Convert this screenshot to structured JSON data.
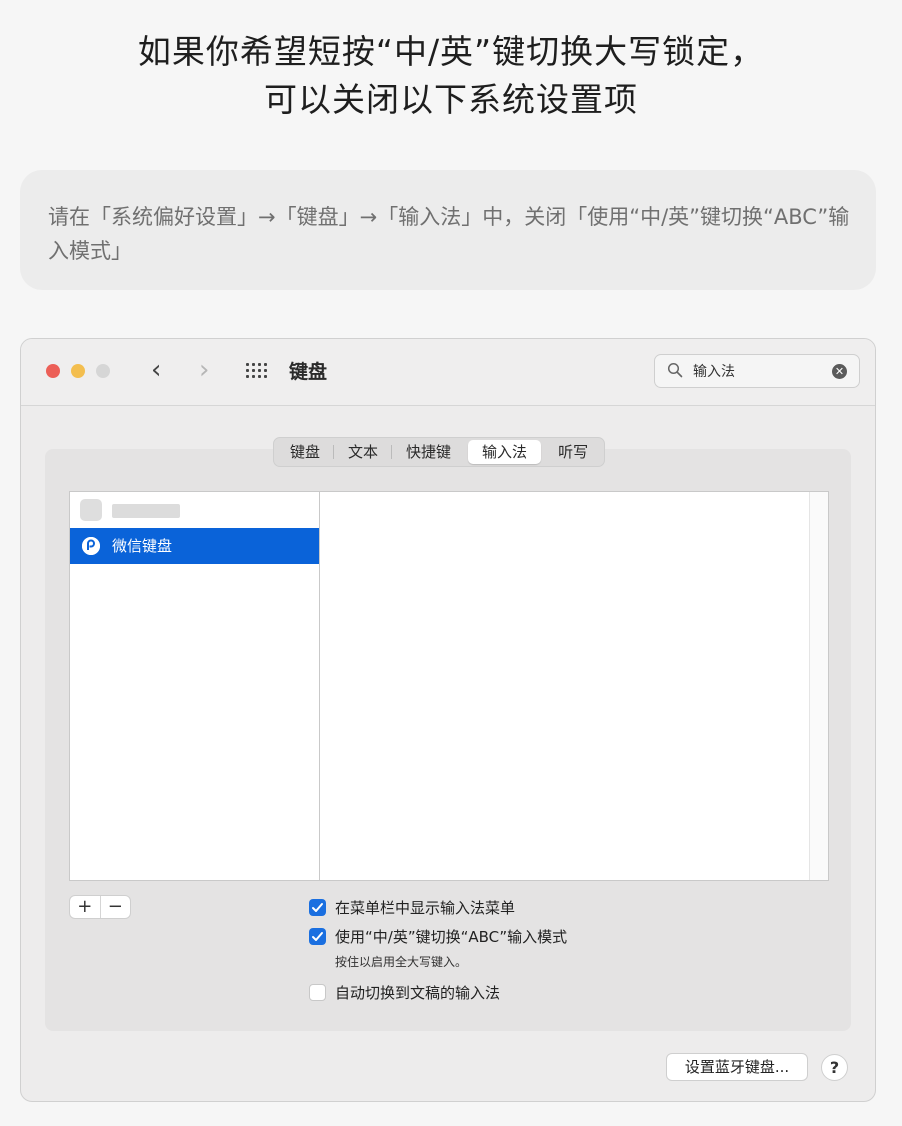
{
  "headline": {
    "line1": "如果你希望短按“中/英”键切换大写锁定，",
    "line2": "可以关闭以下系统设置项"
  },
  "instruction": {
    "text": "请在「系统偏好设置」→「键盘」→「输入法」中，关闭「使用“中/英”键切换“ABC”输入模式」"
  },
  "window": {
    "title": "键盘",
    "search": {
      "value": "输入法"
    },
    "tabs": [
      {
        "label": "键盘",
        "active": false
      },
      {
        "label": "文本",
        "active": false
      },
      {
        "label": "快捷键",
        "active": false
      },
      {
        "label": "输入法",
        "active": true
      },
      {
        "label": "听写",
        "active": false
      }
    ],
    "input_sources": [
      {
        "label": "",
        "placeholder": true
      },
      {
        "label": "微信键盘",
        "selected": true
      }
    ],
    "add_label": "+",
    "remove_label": "−",
    "options": [
      {
        "label": "在菜单栏中显示输入法菜单",
        "checked": true
      },
      {
        "label": "使用“中/英”键切换“ABC”输入模式",
        "checked": true
      },
      {
        "label": "自动切换到文稿的输入法",
        "checked": false
      }
    ],
    "hint": "按住以启用全大写键入。",
    "bluetooth_button": "设置蓝牙键盘...",
    "help_button": "?"
  },
  "colors": {
    "accent": "#1a6fe0",
    "selection": "#0a63d9",
    "close": "#ec5f57",
    "minimize": "#f3be4f"
  }
}
